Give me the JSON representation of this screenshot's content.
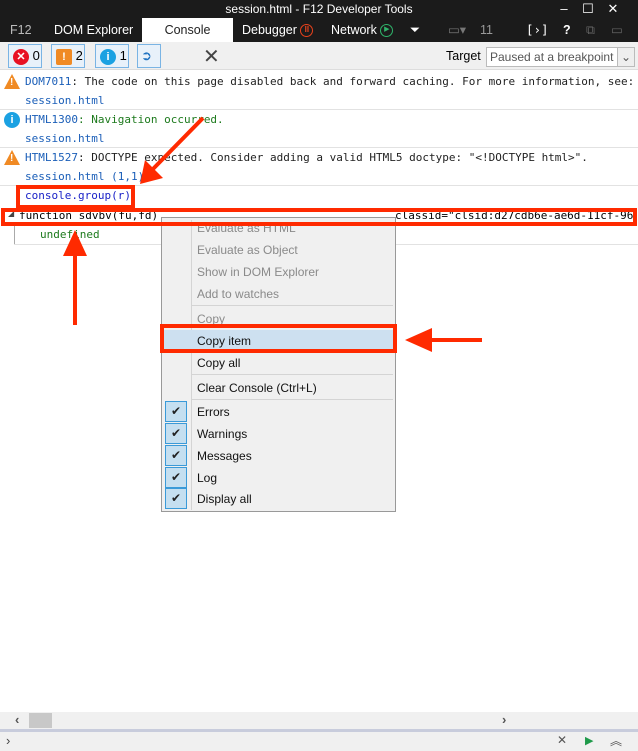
{
  "window": {
    "title": "session.html - F12 Developer Tools",
    "minimize": "–",
    "maximize": "☐",
    "close": "✕"
  },
  "tabs": [
    {
      "label": "F12"
    },
    {
      "label": "DOM Explorer"
    },
    {
      "label": "Console",
      "active": true
    },
    {
      "label": "Debugger"
    },
    {
      "label": "Network"
    }
  ],
  "tabbar_extra": {
    "count": "11",
    "help": "?"
  },
  "toolbar": {
    "errors": "0",
    "warnings": "2",
    "info": "1",
    "target_label": "Target",
    "target_value": "Paused at a breakpoint"
  },
  "messages": [
    {
      "type": "warning",
      "code": "DOM7011",
      "text": ": The code on this page disabled back and forward caching. For more information, see:",
      "source": "session.html"
    },
    {
      "type": "info",
      "code": "HTML1300",
      "text": ": Navigation occurred.",
      "source": "session.html"
    },
    {
      "type": "warning",
      "code": "HTML1527",
      "text": ": DOCTYPE expected. Consider adding a valid HTML5 doctype: \"<!DOCTYPE html>\".",
      "source": "session.html (1,1)"
    }
  ],
  "group": {
    "command": "console.group(r)",
    "function_text": "function sdvbv(fu,fd)",
    "function_tail": "classid=\"clsid:d27cdb6e-ae6d-11cf-96",
    "result": "undefined"
  },
  "context_menu": {
    "items": [
      {
        "label": "Evaluate as HTML",
        "enabled": false
      },
      {
        "label": "Evaluate as Object",
        "enabled": false
      },
      {
        "label": "Show in DOM Explorer",
        "enabled": false
      },
      {
        "label": "Add to watches",
        "enabled": false
      },
      {
        "label": "Copy",
        "enabled": false
      },
      {
        "label": "Copy item",
        "enabled": true,
        "highlighted": true
      },
      {
        "label": "Copy all",
        "enabled": true
      },
      {
        "label": "Clear Console (Ctrl+L)",
        "enabled": true
      }
    ],
    "filters": [
      {
        "label": "Errors",
        "checked": true
      },
      {
        "label": "Warnings",
        "checked": true
      },
      {
        "label": "Messages",
        "checked": true
      },
      {
        "label": "Log",
        "checked": true
      },
      {
        "label": "Display all",
        "checked": true
      }
    ]
  },
  "colors": {
    "annotation": "#ff2a00",
    "highlight": "#cde0f0",
    "warning": "#f08a24",
    "info": "#1ba1e2",
    "error": "#e81123"
  }
}
